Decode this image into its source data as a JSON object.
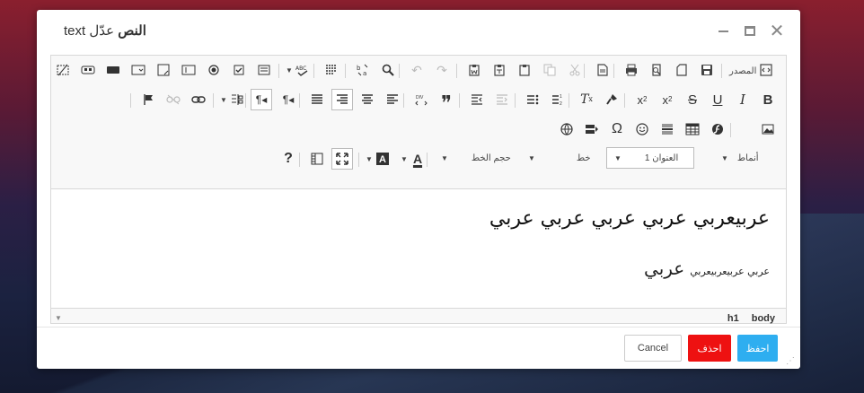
{
  "dialog": {
    "title_verb": "عدّل",
    "title_noun": "النص",
    "title_latin": "text",
    "colors": {
      "save": "#2eaef0",
      "delete": "#ee1111",
      "backdrop": "#2b1f45"
    }
  },
  "toolbar": {
    "source_label": "المصدر",
    "styles_label": "أنماط",
    "format_label": "العنوان 1",
    "font_label": "خط",
    "size_label": "حجم الخط"
  },
  "content": {
    "heading": "عربيعربي عربي عربي عربي عربي",
    "para_small": "عربي عربيعربيعربي",
    "para_big": "عربي"
  },
  "path": {
    "items": [
      "body",
      "h1"
    ]
  },
  "footer": {
    "cancel_label": "Cancel",
    "delete_label": "احذف",
    "save_label": "احفظ"
  }
}
